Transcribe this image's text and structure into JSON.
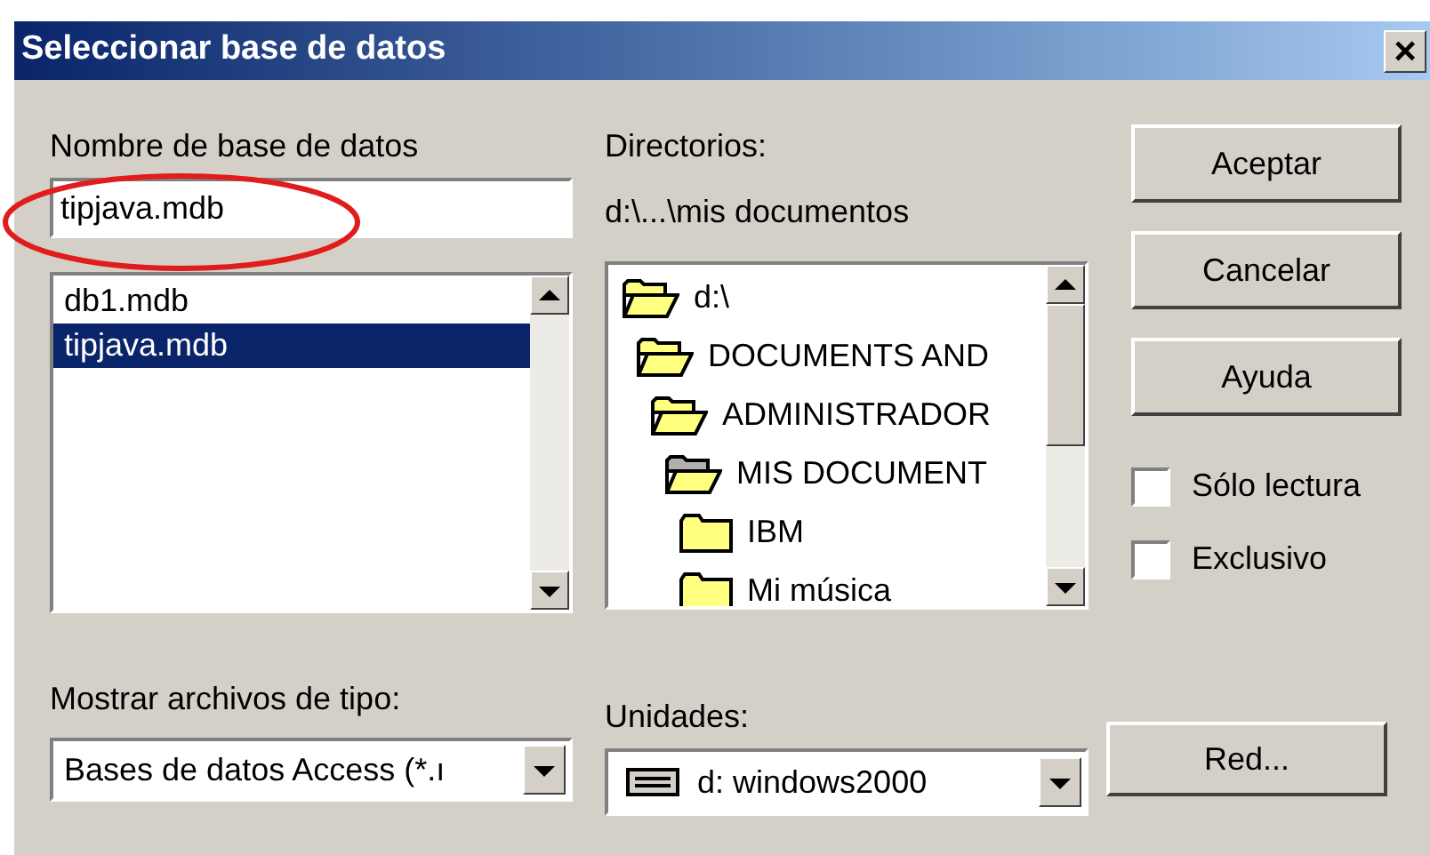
{
  "window": {
    "title": "Seleccionar base de datos",
    "close": "×"
  },
  "database_name": {
    "label": "Nombre de base de datos",
    "value": "tipjava.mdb"
  },
  "highlight_ellipse": {
    "color": "#e01c1c"
  },
  "files": [
    {
      "name": "db1.mdb",
      "selected": false
    },
    {
      "name": "tipjava.mdb",
      "selected": true
    }
  ],
  "directories": {
    "label": "Directorios:",
    "path": "d:\\...\\mis documentos",
    "tree": [
      {
        "name": "d:\\",
        "kind": "open",
        "children": [
          {
            "name": "DOCUMENTS AND",
            "kind": "open",
            "children": [
              {
                "name": "ADMINISTRADOR",
                "kind": "open",
                "children": [
                  {
                    "name": "MIS DOCUMENT",
                    "kind": "current",
                    "children": [
                      {
                        "name": "IBM",
                        "kind": "closed"
                      },
                      {
                        "name": "Mi música",
                        "kind": "closed"
                      }
                    ]
                  }
                ]
              }
            ]
          }
        ]
      }
    ]
  },
  "buttons": [
    {
      "label": "Aceptar"
    },
    {
      "label": "Cancelar"
    },
    {
      "label": "Ayuda"
    }
  ],
  "options": [
    {
      "label": "Sólo lectura",
      "checked": false
    },
    {
      "label": "Exclusivo",
      "checked": false
    }
  ],
  "file_type": {
    "label": "Mostrar archivos de tipo:",
    "value": "Bases de datos Access (*.ı"
  },
  "drives": {
    "label": "Unidades:",
    "value": "d: windows2000"
  },
  "network_button": {
    "label": "Red..."
  }
}
